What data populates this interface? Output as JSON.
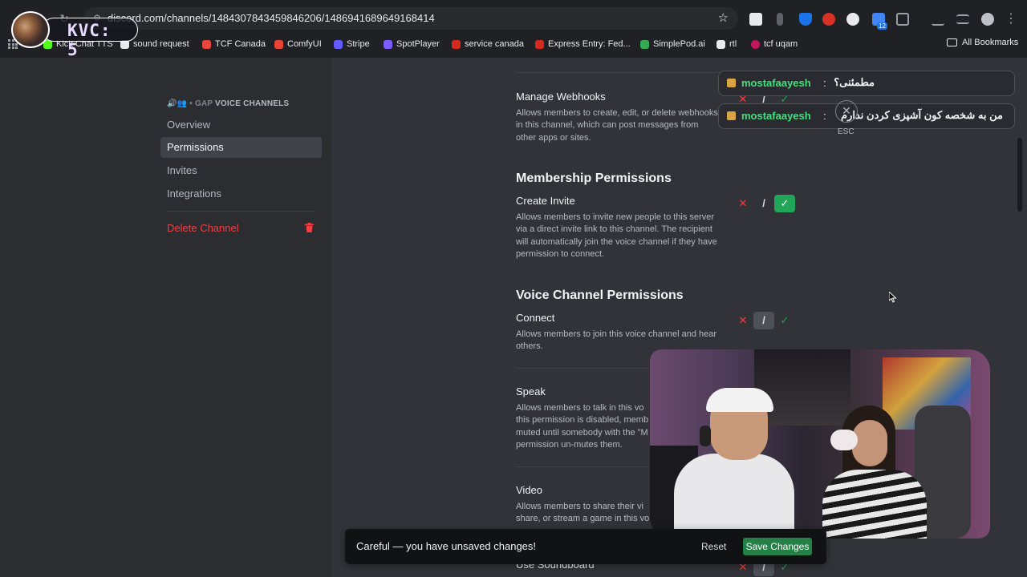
{
  "browser": {
    "url": "discord.com/channels/1484307843459846206/1486941689649168414",
    "bookmarks": [
      {
        "label": "Kick Chat TTS",
        "color": "#53fc18"
      },
      {
        "label": "sound request",
        "color": "#e8eaed"
      },
      {
        "label": "TCF Canada",
        "color": "#e8453c"
      },
      {
        "label": "ComfyUI",
        "color": "#ea4335"
      },
      {
        "label": "Stripe",
        "color": "#635bff"
      },
      {
        "label": "SpotPlayer",
        "color": "#7b5cff"
      },
      {
        "label": "service canada",
        "color": "#d52b1e"
      },
      {
        "label": "Express Entry: Fed...",
        "color": "#d52b1e"
      },
      {
        "label": "SimplePod.ai",
        "color": "#34a853"
      },
      {
        "label": "rtl",
        "color": "#e8eaed"
      },
      {
        "label": "tcf uqam",
        "color": "#c2185b"
      }
    ],
    "all_bookmarks": "All Bookmarks",
    "extension_badge": "12"
  },
  "overlay": {
    "kvc_label": "KVC: 5"
  },
  "sidebar": {
    "header_prefix": "🔊👥 • GAP",
    "header": "VOICE CHANNELS",
    "items": [
      {
        "label": "Overview"
      },
      {
        "label": "Permissions"
      },
      {
        "label": "Invites"
      },
      {
        "label": "Integrations"
      }
    ],
    "delete_label": "Delete Channel"
  },
  "permissions": {
    "manage_webhooks": {
      "title": "Manage Webhooks",
      "desc": "Allows members to create, edit, or delete webhooks in this channel, which can post messages from other apps or sites."
    },
    "membership_section": "Membership Permissions",
    "create_invite": {
      "title": "Create Invite",
      "desc": "Allows members to invite new people to this server via a direct invite link to this channel. The recipient will automatically join the voice channel if they have permission to connect."
    },
    "voice_section": "Voice Channel Permissions",
    "connect": {
      "title": "Connect",
      "desc": "Allows members to join this voice channel and hear others."
    },
    "speak": {
      "title": "Speak",
      "desc": "Allows members to talk in this vo this permission is disabled, memb muted until somebody with the \"M permission un-mutes them."
    },
    "video": {
      "title": "Video",
      "desc": "Allows members to share their vi share, or stream a game in this vo"
    },
    "soundboard": {
      "title": "Use Soundboard"
    },
    "toggle_symbols": {
      "deny": "✕",
      "neutral": "/",
      "allow": "✓"
    }
  },
  "chat_overlay": {
    "messages": [
      {
        "user": "mostafaayesh",
        "text": "مطمئنی؟"
      },
      {
        "user": "mostafaayesh",
        "text": "من به شخصه کون آشپزی کردن ندارم"
      }
    ],
    "esc_label": "ESC"
  },
  "unsaved_bar": {
    "message": "Careful — you have unsaved changes!",
    "reset": "Reset",
    "save": "Save Changes"
  }
}
